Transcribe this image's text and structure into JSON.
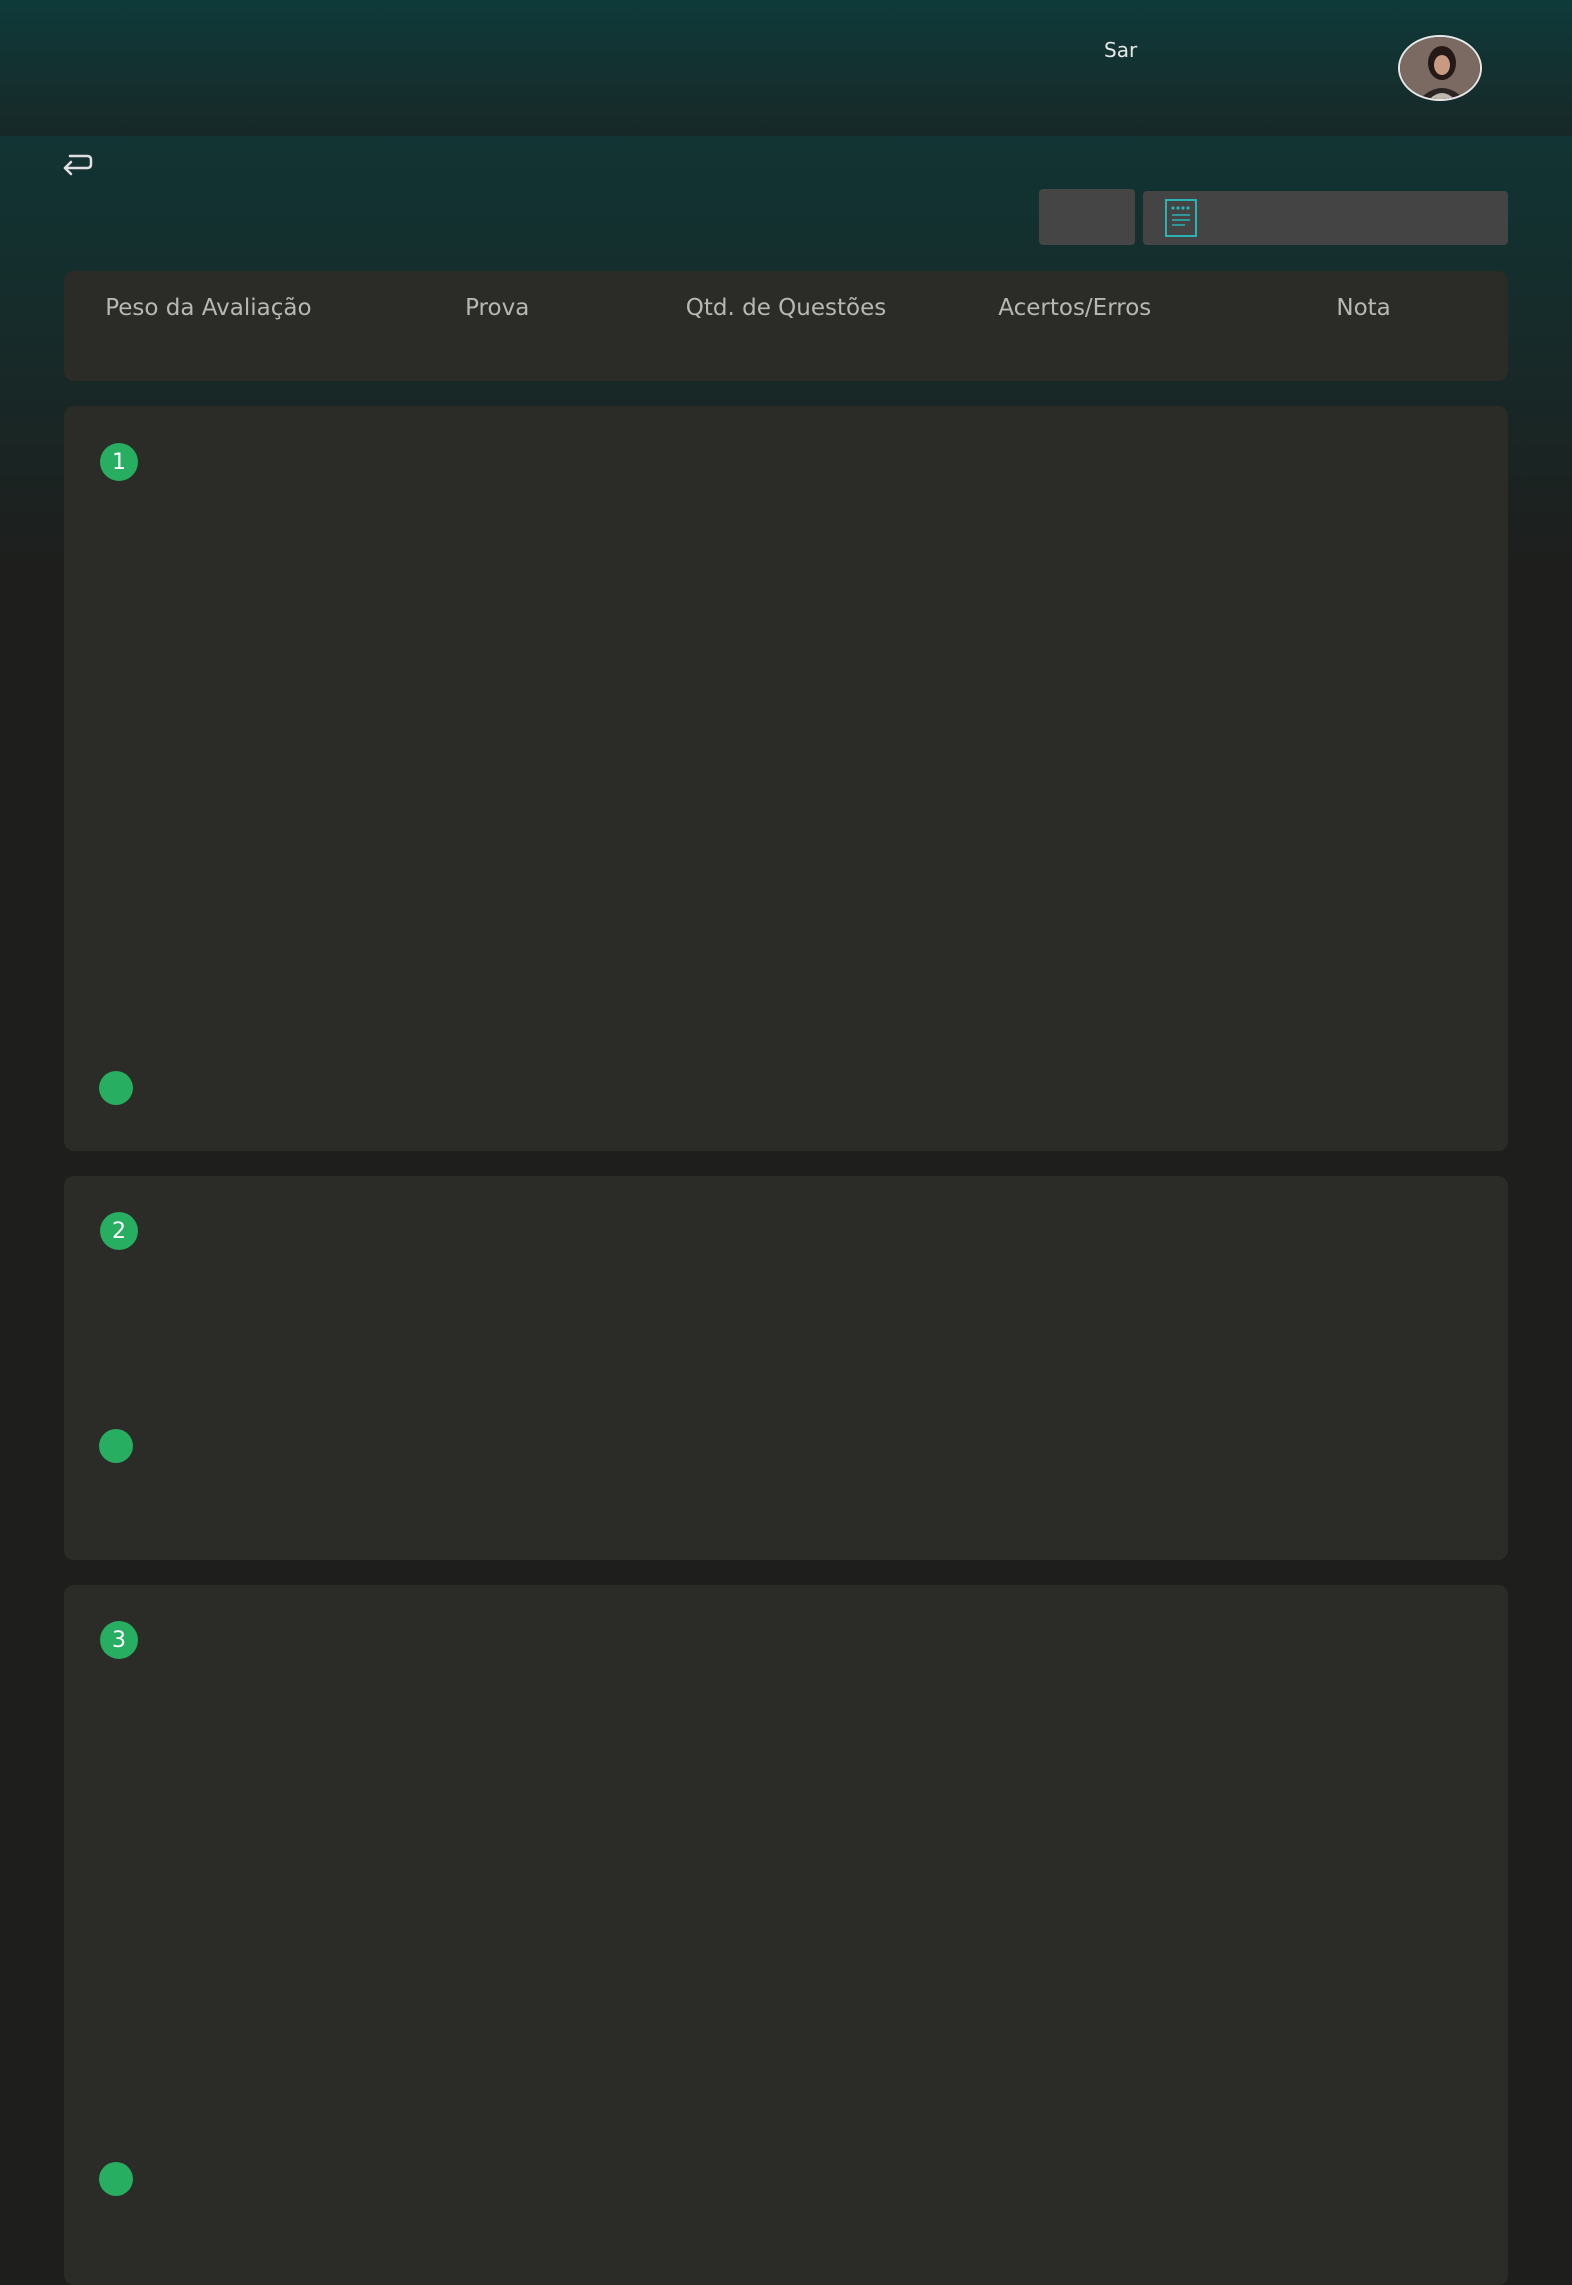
{
  "header": {
    "user_name": "Sar"
  },
  "colors": {
    "accent": "#27ae60",
    "teal": "#2ab3b3",
    "panel": "#2b2b28",
    "background": "#1e1e1c"
  },
  "icons": {
    "back": "return-arrow-icon",
    "document": "document-icon"
  },
  "table_header": {
    "columns": [
      "Peso da Avaliação",
      "Prova",
      "Qtd. de Questões",
      "Acertos/Erros",
      "Nota"
    ]
  },
  "cards": [
    {
      "number": "1"
    },
    {
      "number": "2"
    },
    {
      "number": "3"
    }
  ]
}
